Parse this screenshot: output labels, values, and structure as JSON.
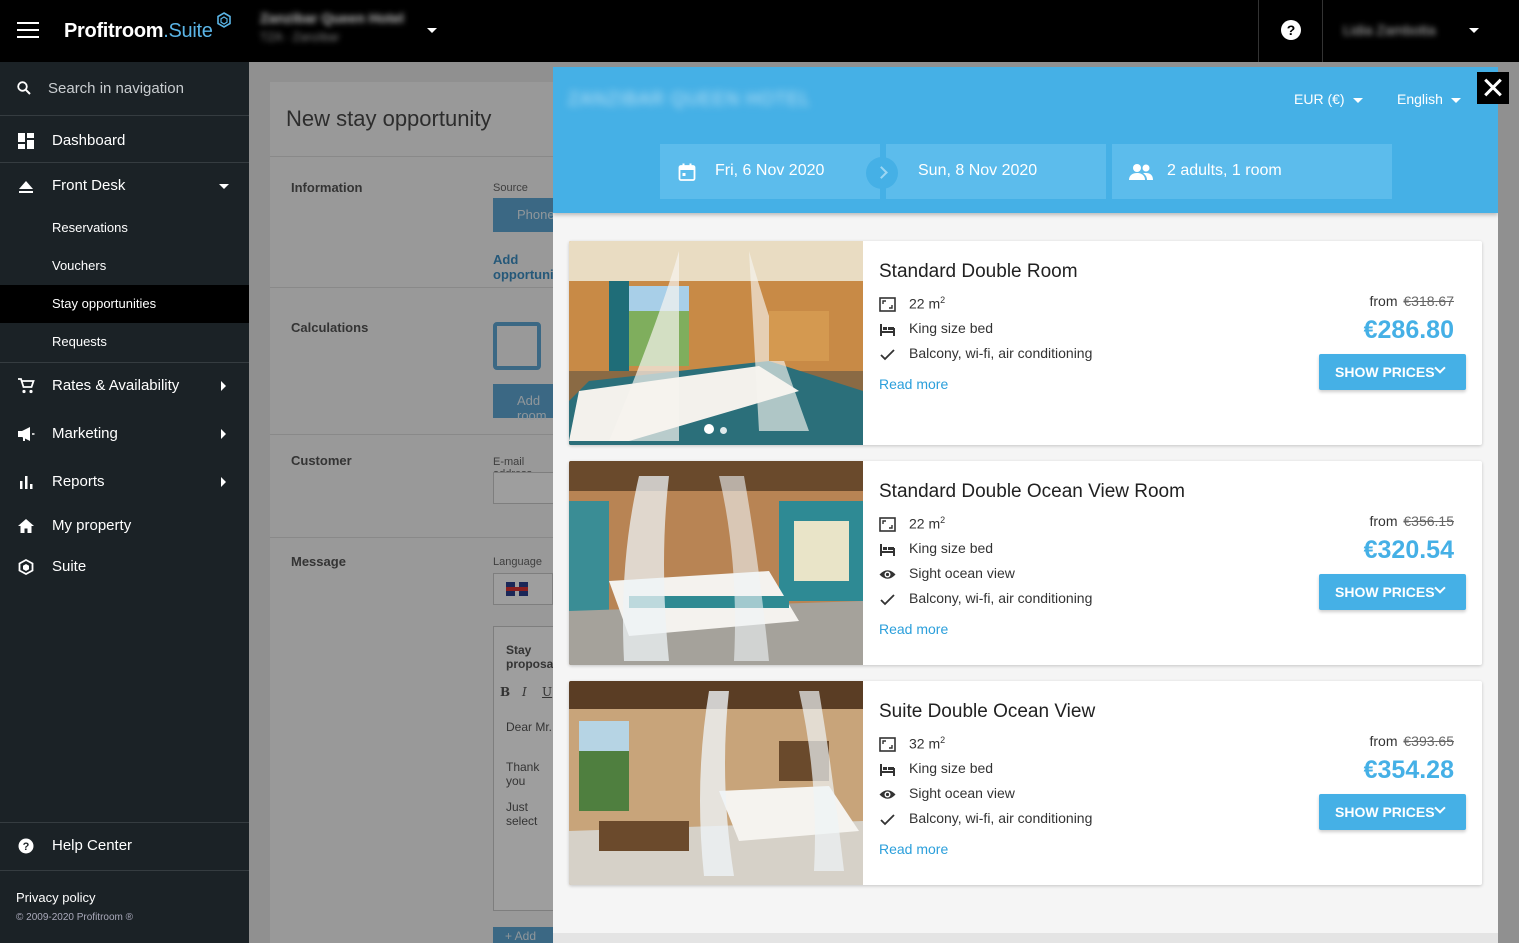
{
  "topbar": {
    "brand_main": "Profitroom",
    "brand_dot": ".",
    "brand_suite": "Suite",
    "hotel_name": "Zanzibar Queen Hotel",
    "hotel_sub": "TZA · Zanzibar",
    "user_name": "Lidia Zambotta",
    "help_label": "?"
  },
  "sidebar": {
    "search_placeholder": "Search in navigation",
    "items": [
      {
        "label": "Dashboard",
        "icon": "dashboard-icon"
      },
      {
        "label": "Front Desk",
        "icon": "eject-icon",
        "expanded": true
      },
      {
        "label": "Reservations"
      },
      {
        "label": "Vouchers"
      },
      {
        "label": "Stay opportunities",
        "active": true
      },
      {
        "label": "Requests"
      },
      {
        "label": "Rates & Availability",
        "icon": "cart-icon"
      },
      {
        "label": "Marketing",
        "icon": "megaphone-icon"
      },
      {
        "label": "Reports",
        "icon": "bar-chart-icon"
      },
      {
        "label": "My property",
        "icon": "home-icon"
      },
      {
        "label": "Suite",
        "icon": "suite-logo-icon"
      }
    ],
    "help_center": "Help Center",
    "privacy": "Privacy policy",
    "copyright": "© 2009-2020 Profitroom ®"
  },
  "background_page": {
    "title": "New stay opportunity",
    "sections": {
      "information": "Information",
      "calculations": "Calculations",
      "customer": "Customer",
      "message": "Message"
    },
    "source_label": "Source",
    "source_button": "Phone",
    "add_opportunity_link": "Add opportunity",
    "add_room_button": "Add room",
    "email_label": "E-mail address",
    "language_label": "Language",
    "message_title": "Stay proposal",
    "format_bold": "B",
    "format_italic": "I",
    "format_underline": "U",
    "message_lines": [
      "Dear Mr.",
      "Thank you",
      "Just select"
    ],
    "add_button": "+ Add"
  },
  "modal": {
    "hotel_name": "ZANZIBAR QUEEN HOTEL",
    "currency": "EUR (€)",
    "language": "English",
    "checkin": "Fri, 6 Nov 2020",
    "checkout": "Sun, 8 Nov 2020",
    "guests": "2 adults, 1 room",
    "accent_color": "#45b0e6",
    "rooms": [
      {
        "name": "Standard Double Room",
        "area": "22 m",
        "bed": "King size bed",
        "view": "",
        "amenities": "Balcony, wi-fi, air conditioning",
        "read_more": "Read more",
        "from_label": "from",
        "old_price": "€318.67",
        "price": "€286.80",
        "button": "SHOW PRICES"
      },
      {
        "name": "Standard Double Ocean View Room",
        "area": "22 m",
        "bed": "King size bed",
        "view": "Sight ocean view",
        "amenities": "Balcony, wi-fi, air conditioning",
        "read_more": "Read more",
        "from_label": "from",
        "old_price": "€356.15",
        "price": "€320.54",
        "button": "SHOW PRICES"
      },
      {
        "name": "Suite Double Ocean View",
        "area": "32 m",
        "bed": "King size bed",
        "view": "Sight ocean view",
        "amenities": "Balcony, wi-fi, air conditioning",
        "read_more": "Read more",
        "from_label": "from",
        "old_price": "€393.65",
        "price": "€354.28",
        "button": "SHOW PRICES"
      }
    ]
  }
}
